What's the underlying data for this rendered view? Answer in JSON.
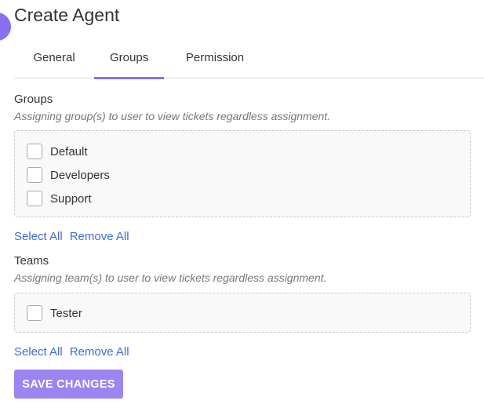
{
  "header": {
    "title": "Create Agent"
  },
  "tabs": [
    {
      "label": "General"
    },
    {
      "label": "Groups"
    },
    {
      "label": "Permission"
    }
  ],
  "active_tab": "Groups",
  "groups": {
    "label": "Groups",
    "hint": "Assigning group(s) to user to view tickets regardless assignment.",
    "items": [
      {
        "label": "Default",
        "checked": false
      },
      {
        "label": "Developers",
        "checked": false
      },
      {
        "label": "Support",
        "checked": false
      }
    ],
    "select_all": "Select All",
    "remove_all": "Remove All"
  },
  "teams": {
    "label": "Teams",
    "hint": "Assigning team(s) to user to view tickets regardless assignment.",
    "items": [
      {
        "label": "Tester",
        "checked": false
      }
    ],
    "select_all": "Select All",
    "remove_all": "Remove All"
  },
  "actions": {
    "save_label": "SAVE CHANGES"
  },
  "colors": {
    "accent": "#8a6ff0",
    "button": "#9c85f2",
    "link": "#3f6ad8"
  }
}
